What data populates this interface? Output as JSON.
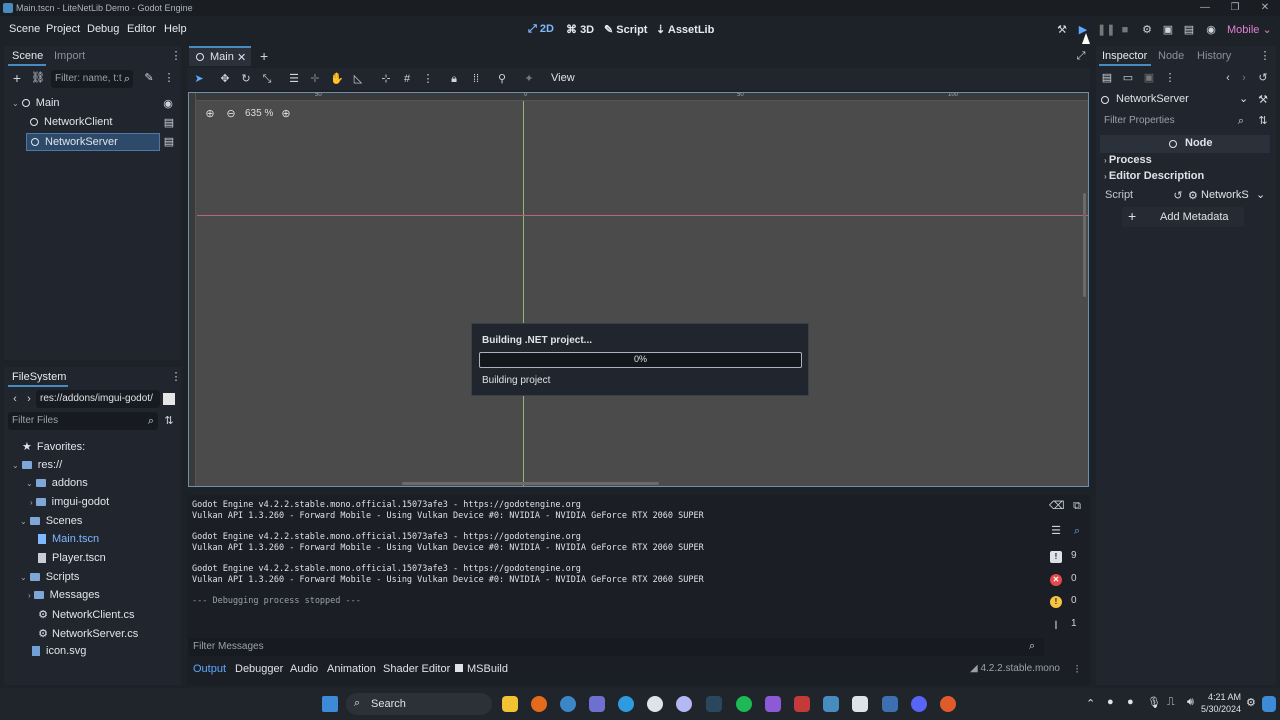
{
  "window": {
    "title": "Main.tscn - LiteNetLib Demo - Godot Engine",
    "controls": {
      "minimize": "—",
      "maximize": "❐",
      "close": "✕"
    }
  },
  "menu": {
    "items": [
      "Scene",
      "Project",
      "Debug",
      "Editor",
      "Help"
    ]
  },
  "workspaces": {
    "items": [
      "2D",
      "3D",
      "Script",
      "AssetLib"
    ],
    "active": "2D"
  },
  "renderer": "Mobile",
  "scene_dock": {
    "tabs": [
      "Scene",
      "Import"
    ],
    "filter_placeholder": "Filter: name, t:t",
    "root": "Main",
    "children": [
      "NetworkClient",
      "NetworkServer"
    ],
    "selected": "NetworkServer"
  },
  "editor_tabs": {
    "scene_tab": "Main",
    "close": "✕",
    "add": "+"
  },
  "toolbar": {
    "view_label": "View"
  },
  "viewport": {
    "zoom": "635 %",
    "ruler_labels": [
      "50",
      "0",
      "50",
      "100"
    ],
    "grid_color": "#4b4b4b"
  },
  "build_dialog": {
    "title": "Building .NET project...",
    "progress_text": "0%",
    "progress": 0,
    "status": "Building project"
  },
  "filesystem": {
    "title": "FileSystem",
    "path": "res://addons/imgui-godot/",
    "filter_placeholder": "Filter Files",
    "favorites": "Favorites:",
    "items": [
      {
        "label": "res://",
        "kind": "folder"
      },
      {
        "label": "addons",
        "kind": "folder"
      },
      {
        "label": "imgui-godot",
        "kind": "folder"
      },
      {
        "label": "Scenes",
        "kind": "folder"
      },
      {
        "label": "Main.tscn",
        "kind": "scene"
      },
      {
        "label": "Player.tscn",
        "kind": "scene"
      },
      {
        "label": "Scripts",
        "kind": "folder"
      },
      {
        "label": "Messages",
        "kind": "folder"
      },
      {
        "label": "NetworkClient.cs",
        "kind": "script"
      },
      {
        "label": "NetworkServer.cs",
        "kind": "script"
      },
      {
        "label": "icon.svg",
        "kind": "image"
      }
    ]
  },
  "inspector": {
    "tabs": [
      "Inspector",
      "Node",
      "History"
    ],
    "object": "NetworkServer",
    "filter_placeholder": "Filter Properties",
    "class_label": "Node",
    "sections": [
      "Process",
      "Editor Description"
    ],
    "script_label": "Script",
    "script_value": "NetworkS",
    "add_metadata": "Add Metadata"
  },
  "output": {
    "lines": [
      "Godot Engine v4.2.2.stable.mono.official.15073afe3 - https://godotengine.org",
      "Vulkan API 1.3.260 - Forward Mobile - Using Vulkan Device #0: NVIDIA - NVIDIA GeForce RTX 2060 SUPER",
      "",
      "Godot Engine v4.2.2.stable.mono.official.15073afe3 - https://godotengine.org",
      "Vulkan API 1.3.260 - Forward Mobile - Using Vulkan Device #0: NVIDIA - NVIDIA GeForce RTX 2060 SUPER",
      "",
      "Godot Engine v4.2.2.stable.mono.official.15073afe3 - https://godotengine.org",
      "Vulkan API 1.3.260 - Forward Mobile - Using Vulkan Device #0: NVIDIA - NVIDIA GeForce RTX 2060 SUPER",
      "",
      "--- Debugging process stopped ---"
    ],
    "filter_placeholder": "Filter Messages",
    "counters": {
      "messages": "9",
      "errors": "0",
      "warnings": "0",
      "editor": "1"
    }
  },
  "bottom_tabs": [
    "Output",
    "Debugger",
    "Audio",
    "Animation",
    "Shader Editor",
    "MSBuild"
  ],
  "version": "4.2.2.stable.mono",
  "taskbar": {
    "search": "Search",
    "time": "4:21 AM",
    "date": "5/30/2024"
  },
  "colors": {
    "accent": "#478cbf",
    "selection": "#2e4a6b",
    "error": "#e5484d",
    "warning": "#f5c542"
  }
}
